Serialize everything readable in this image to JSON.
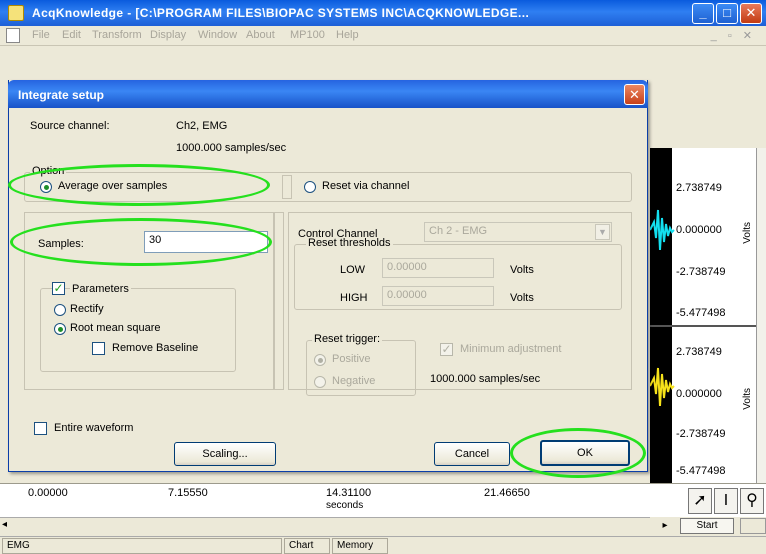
{
  "app": {
    "title": "AcqKnowledge - [C:\\PROGRAM FILES\\BIOPAC SYSTEMS INC\\ACQKNOWLEDGE...",
    "menu": [
      "File",
      "Edit",
      "Transform",
      "Display",
      "Window",
      "About",
      "MP100",
      "Help"
    ]
  },
  "chart": {
    "upper_values": [
      "2.738749",
      "0.000000",
      "-2.738749",
      "-5.477498"
    ],
    "lower_values": [
      "2.738749",
      "0.000000",
      "-2.738749",
      "-5.477498"
    ],
    "unit": "Volts",
    "upper_wave_color": "#13e0f0",
    "lower_wave_color": "#f6e21a"
  },
  "time_axis": {
    "ticks": [
      "0.00000",
      "7.15550",
      "14.31100",
      "21.46650"
    ],
    "unit": "seconds"
  },
  "tools": {
    "arrow_icon": "pointer-icon",
    "ibeam_icon": "ibeam-icon",
    "zoom_icon": "magnifier-icon",
    "start_label": "Start"
  },
  "status": {
    "channel": "EMG",
    "chart_label": "Chart",
    "memory_label": "Memory"
  },
  "dialog": {
    "title": "Integrate setup",
    "source_channel_label": "Source channel:",
    "source_channel_value": "Ch2, EMG",
    "sample_rate": "1000.000 samples/sec",
    "option_group_label": "Option",
    "average_label": "Average over samples",
    "reset_channel_label": "Reset via channel",
    "samples_label": "Samples:",
    "samples_value": "30",
    "parameters_label": "Parameters",
    "rectify_label": "Rectify",
    "rms_label": "Root mean square",
    "remove_baseline_label": "Remove Baseline",
    "control_channel_label": "Control Channel",
    "control_channel_value": "Ch 2 - EMG",
    "reset_thresholds_label": "Reset thresholds",
    "low_label": "LOW",
    "low_value": "0.00000",
    "high_label": "HIGH",
    "high_value": "0.00000",
    "volts_label": "Volts",
    "reset_trigger_label": "Reset trigger:",
    "positive_label": "Positive",
    "negative_label": "Negative",
    "minimum_adjustment_label": "Minimum adjustment",
    "control_sample_rate": "1000.000 samples/sec",
    "entire_waveform_label": "Entire waveform",
    "scaling_button": "Scaling...",
    "cancel_button": "Cancel",
    "ok_button": "OK",
    "highlight_color": "#25e01e"
  }
}
